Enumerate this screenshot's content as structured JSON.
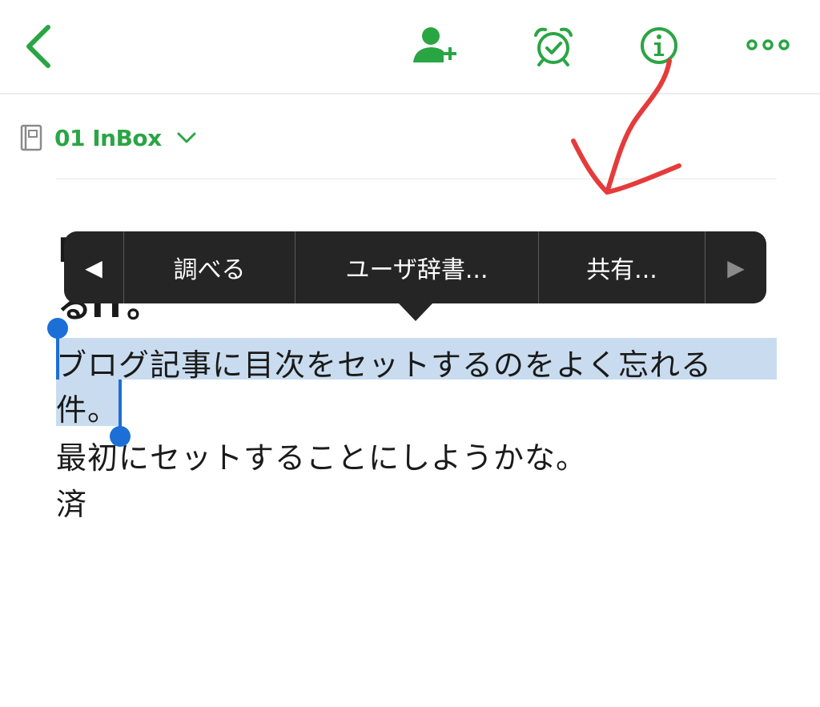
{
  "toolbar": {
    "back_icon": "chevron-left-icon",
    "share_icon": "add-person-icon",
    "reminder_icon": "alarm-clock-icon",
    "info_icon": "info-icon",
    "more_icon": "more-dots-icon",
    "accent_color": "#2aa544"
  },
  "notebook": {
    "icon": "notebook-icon",
    "name": "01 InBox",
    "chevron": "chevron-down-icon"
  },
  "note": {
    "lines": [
      "ブログ記事に目次をセットするのをよく忘れる",
      "件。",
      "最初にセットすることにしようかな。",
      "済"
    ],
    "selection_color": "#c9dcef",
    "handle_color": "#1c6fd6"
  },
  "context_menu": {
    "prev_arrow": "◀",
    "items": [
      "調べる",
      "ユーザ辞書...",
      "共有..."
    ],
    "next_arrow": "▶"
  },
  "annotation": {
    "color": "#e53b3b",
    "type": "hand-drawn-arrow"
  }
}
